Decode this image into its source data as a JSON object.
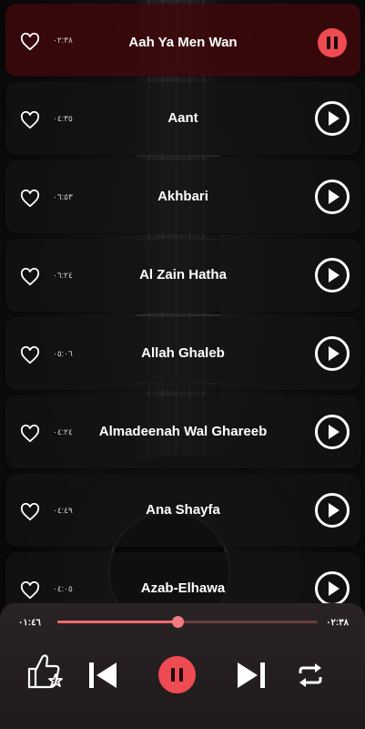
{
  "songs": [
    {
      "title": "Aah Ya Men Wan",
      "duration": "٠٢:٣٨",
      "playing": true
    },
    {
      "title": "Aant",
      "duration": "٠٤:٣٥",
      "playing": false
    },
    {
      "title": "Akhbari",
      "duration": "٠٦:٥٣",
      "playing": false
    },
    {
      "title": "Al Zain Hatha",
      "duration": "٠٦:٢٤",
      "playing": false
    },
    {
      "title": "Allah Ghaleb",
      "duration": "٠٥:٠٦",
      "playing": false
    },
    {
      "title": "Almadeenah Wal Ghareeb",
      "duration": "٠٤:٢٤",
      "playing": false
    },
    {
      "title": "Ana Shayfa",
      "duration": "٠٤:٤٩",
      "playing": false
    },
    {
      "title": "Azab-Elhawa",
      "duration": "٠٤:٠٥",
      "playing": false
    }
  ],
  "player": {
    "elapsed": "٠١:٤٦",
    "total": "٠٢:٣٨",
    "progress_fraction": 0.46
  },
  "icons": {
    "like": "thumbs-up-star-icon",
    "prev": "skip-previous-icon",
    "pause": "pause-icon",
    "next": "skip-next-icon",
    "repeat": "repeat-icon",
    "favorite": "heart-outline-icon",
    "play": "play-icon"
  },
  "colors": {
    "accent": "#ef4b52",
    "active_row": "#3c080a",
    "progress": "#f06a70"
  }
}
